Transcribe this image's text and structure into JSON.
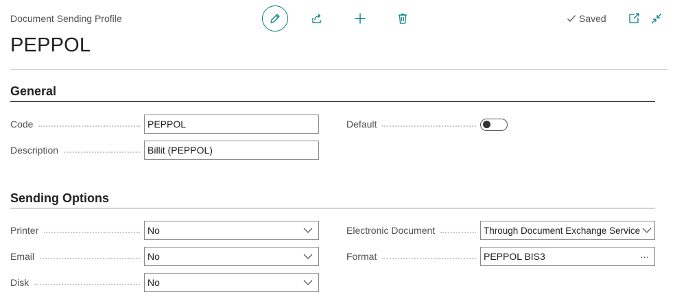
{
  "header": {
    "caption": "Document Sending Profile",
    "title": "PEPPOL",
    "saved_label": "Saved"
  },
  "actions": {
    "edit_icon": "pencil-icon",
    "share_icon": "share-icon",
    "new_icon": "plus-icon",
    "delete_icon": "trash-icon",
    "open_new_window_icon": "open-in-new-window-icon",
    "collapse_icon": "collapse-icon"
  },
  "general": {
    "title": "General",
    "code_label": "Code",
    "code_value": "PEPPOL",
    "description_label": "Description",
    "description_value": "Billit (PEPPOL)",
    "default_label": "Default",
    "default_value": false
  },
  "sending_options": {
    "title": "Sending Options",
    "printer_label": "Printer",
    "printer_value": "No",
    "email_label": "Email",
    "email_value": "No",
    "disk_label": "Disk",
    "disk_value": "No",
    "electronic_document_label": "Electronic Document",
    "electronic_document_value": "Through Document Exchange Service",
    "format_label": "Format",
    "format_value": "PEPPOL BIS3",
    "format_lookup": "···"
  },
  "colors": {
    "accent": "#00807f",
    "text": "#212121",
    "label": "#505050"
  }
}
